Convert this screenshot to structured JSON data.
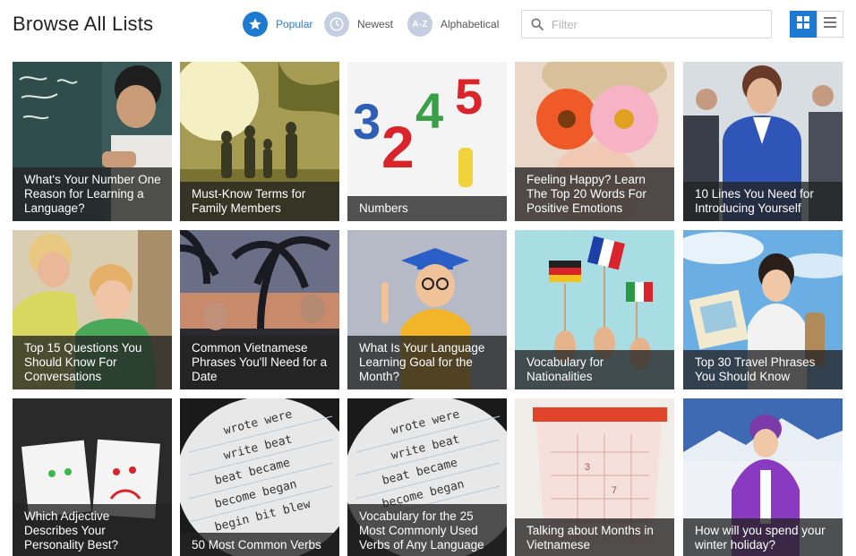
{
  "header": {
    "title": "Browse All Lists",
    "sort_options": [
      {
        "label": "Popular",
        "icon": "star-icon",
        "active": true
      },
      {
        "label": "Newest",
        "icon": "clock-icon",
        "active": false
      },
      {
        "label": "Alphabetical",
        "icon": "az-icon",
        "badge": "A-Z",
        "active": false
      }
    ],
    "search": {
      "placeholder": "Filter",
      "value": ""
    },
    "view_modes": [
      "grid",
      "list"
    ],
    "active_view": "grid"
  },
  "colors": {
    "accent": "#1d7ad0",
    "inactive_icon": "#c3cfe0",
    "caption_bg": "#222222"
  },
  "lists": [
    {
      "title": "What's Your Number One Reason for Learning a Language?"
    },
    {
      "title": "Must-Know Terms for Family Members"
    },
    {
      "title": "Numbers"
    },
    {
      "title": "Feeling Happy? Learn The Top 20 Words For Positive Emotions"
    },
    {
      "title": "10 Lines You Need for Introducing Yourself"
    },
    {
      "title": "Top 15 Questions You Should Know For Conversations"
    },
    {
      "title": "Common Vietnamese Phrases You'll Need for a Date"
    },
    {
      "title": "What Is Your Language Learning Goal for the Month?"
    },
    {
      "title": "Vocabulary for Nationalities"
    },
    {
      "title": "Top 30 Travel Phrases You Should Know"
    },
    {
      "title": "Which Adjective Describes Your Personality Best?"
    },
    {
      "title": "50 Most Common Verbs"
    },
    {
      "title": "Vocabulary for the 25 Most Commonly Used Verbs of Any Language"
    },
    {
      "title": "Talking about Months in Vietnamese"
    },
    {
      "title": "How will you spend your winter holiday?"
    }
  ]
}
